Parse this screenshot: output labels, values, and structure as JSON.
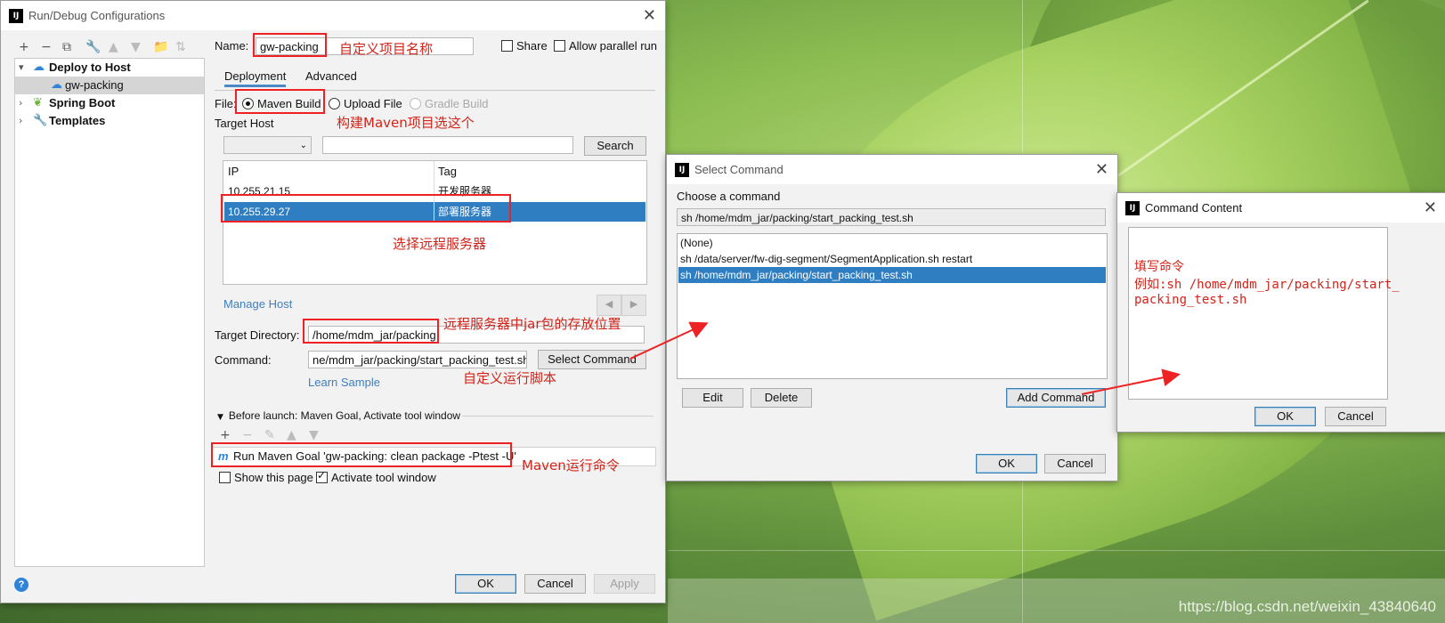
{
  "main_dialog": {
    "title": "Run/Debug Configurations",
    "toolbar_icons": [
      "add-icon",
      "remove-icon",
      "copy-icon",
      "wrench-icon",
      "move-up-icon",
      "move-down-icon",
      "folder-icon",
      "sort-icon"
    ],
    "tree": [
      {
        "label": "Deploy to Host",
        "expanded": true
      },
      {
        "label": "gw-packing"
      },
      {
        "label": "Spring Boot"
      },
      {
        "label": "Templates"
      }
    ],
    "name_label": "Name:",
    "name_value": "gw-packing",
    "share_label": "Share",
    "allow_parallel_label": "Allow parallel run",
    "tabs": [
      "Deployment",
      "Advanced"
    ],
    "file_label": "File:",
    "file_options": [
      "Maven Build",
      "Upload File",
      "Gradle Build"
    ],
    "target_host_label": "Target Host",
    "search_button": "Search",
    "table_headers": [
      "IP",
      "Tag"
    ],
    "table_rows": [
      {
        "ip": "10.255.21.15",
        "tag": "开发服务器"
      },
      {
        "ip": "10.255.29.27",
        "tag": "部署服务器"
      }
    ],
    "manage_host": "Manage Host",
    "target_dir_label": "Target Directory:",
    "target_dir_value": "/home/mdm_jar/packing",
    "command_label": "Command:",
    "command_value": "ne/mdm_jar/packing/start_packing_test.sh",
    "select_command_button": "Select Command",
    "learn_sample": "Learn Sample",
    "before_launch": "Before launch: Maven Goal, Activate tool window",
    "maven_goal": "Run Maven Goal 'gw-packing: clean package -Ptest -U'",
    "show_page_label": "Show this page",
    "activate_tool_label": "Activate tool window",
    "ok": "OK",
    "cancel": "Cancel",
    "apply": "Apply",
    "help": "?"
  },
  "select_command": {
    "title": "Select Command",
    "choose_label": "Choose a command",
    "current": "sh /home/mdm_jar/packing/start_packing_test.sh",
    "items": [
      "(None)",
      "sh /data/server/fw-dig-segment/SegmentApplication.sh restart",
      "sh /home/mdm_jar/packing/start_packing_test.sh"
    ],
    "edit": "Edit",
    "delete": "Delete",
    "add_command": "Add Command",
    "ok": "OK",
    "cancel": "Cancel"
  },
  "command_content": {
    "title": "Command Content",
    "ok": "OK",
    "cancel": "Cancel"
  },
  "annotations": {
    "name_note": "自定义项目名称",
    "maven_note": "构建Maven项目选这个",
    "server_note": "选择远程服务器",
    "jar_note": "远程服务器中jar包的存放位置",
    "script_note": "自定义运行脚本",
    "maven_cmd_note": "Maven运行命令",
    "fill_note": "填写命令",
    "example_line1": "例如:sh /home/mdm_jar/packing/start_",
    "example_line2": "packing_test.sh"
  },
  "watermark": "https://blog.csdn.net/weixin_43840640"
}
